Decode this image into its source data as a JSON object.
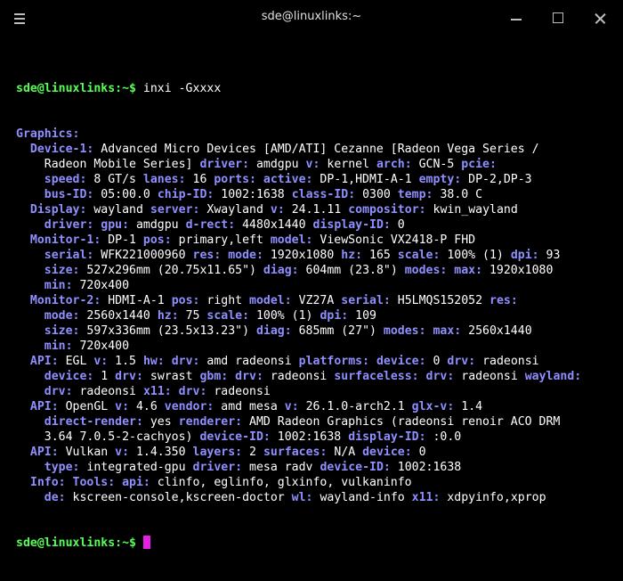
{
  "window": {
    "title": "sde@linuxlinks:~",
    "menu_icon": "hamburger-menu-icon",
    "minimize_icon": "minimize-icon",
    "maximize_icon": "maximize-icon",
    "close_icon": "close-icon"
  },
  "colors": {
    "background": "#000000",
    "prompt": "#55ff55",
    "key": "#8f8fff",
    "value": "#ffffff",
    "cursor": "#e61ee6"
  },
  "terminal": {
    "prompt": "sde@linuxlinks:~$",
    "command": " inxi -Gxxxx",
    "lines": [
      [
        [
          "k",
          "Graphics:"
        ]
      ],
      [
        [
          "k",
          "  Device-1: "
        ],
        [
          "v",
          "Advanced Micro Devices [AMD/ATI] Cezanne [Radeon Vega Series /"
        ]
      ],
      [
        [
          "v",
          "    Radeon Mobile Series] "
        ],
        [
          "k",
          "driver: "
        ],
        [
          "v",
          "amdgpu "
        ],
        [
          "k",
          "v: "
        ],
        [
          "v",
          "kernel "
        ],
        [
          "k",
          "arch: "
        ],
        [
          "v",
          "GCN-5 "
        ],
        [
          "k",
          "pcie:"
        ]
      ],
      [
        [
          "k",
          "    speed: "
        ],
        [
          "v",
          "8 GT/s "
        ],
        [
          "k",
          "lanes: "
        ],
        [
          "v",
          "16 "
        ],
        [
          "k",
          "ports: active: "
        ],
        [
          "v",
          "DP-1,HDMI-A-1 "
        ],
        [
          "k",
          "empty: "
        ],
        [
          "v",
          "DP-2,DP-3"
        ]
      ],
      [
        [
          "k",
          "    bus-ID: "
        ],
        [
          "v",
          "05:00.0 "
        ],
        [
          "k",
          "chip-ID: "
        ],
        [
          "v",
          "1002:1638 "
        ],
        [
          "k",
          "class-ID: "
        ],
        [
          "v",
          "0300 "
        ],
        [
          "k",
          "temp: "
        ],
        [
          "v",
          "38.0 C"
        ]
      ],
      [
        [
          "k",
          "  Display: "
        ],
        [
          "v",
          "wayland "
        ],
        [
          "k",
          "server: "
        ],
        [
          "v",
          "Xwayland "
        ],
        [
          "k",
          "v: "
        ],
        [
          "v",
          "24.1.11 "
        ],
        [
          "k",
          "compositor: "
        ],
        [
          "v",
          "kwin_wayland"
        ]
      ],
      [
        [
          "k",
          "    driver: gpu: "
        ],
        [
          "v",
          "amdgpu "
        ],
        [
          "k",
          "d-rect: "
        ],
        [
          "v",
          "4480x1440 "
        ],
        [
          "k",
          "display-ID: "
        ],
        [
          "v",
          "0"
        ]
      ],
      [
        [
          "k",
          "  Monitor-1: "
        ],
        [
          "v",
          "DP-1 "
        ],
        [
          "k",
          "pos: "
        ],
        [
          "v",
          "primary,left "
        ],
        [
          "k",
          "model: "
        ],
        [
          "v",
          "ViewSonic VX2418-P FHD"
        ]
      ],
      [
        [
          "k",
          "    serial: "
        ],
        [
          "v",
          "WFK221000960 "
        ],
        [
          "k",
          "res: mode: "
        ],
        [
          "v",
          "1920x1080 "
        ],
        [
          "k",
          "hz: "
        ],
        [
          "v",
          "165 "
        ],
        [
          "k",
          "scale: "
        ],
        [
          "v",
          "100% (1) "
        ],
        [
          "k",
          "dpi: "
        ],
        [
          "v",
          "93"
        ]
      ],
      [
        [
          "k",
          "    size: "
        ],
        [
          "v",
          "527x296mm (20.75x11.65\") "
        ],
        [
          "k",
          "diag: "
        ],
        [
          "v",
          "604mm (23.8\") "
        ],
        [
          "k",
          "modes: max: "
        ],
        [
          "v",
          "1920x1080"
        ]
      ],
      [
        [
          "k",
          "    min: "
        ],
        [
          "v",
          "720x400"
        ]
      ],
      [
        [
          "k",
          "  Monitor-2: "
        ],
        [
          "v",
          "HDMI-A-1 "
        ],
        [
          "k",
          "pos: "
        ],
        [
          "v",
          "right "
        ],
        [
          "k",
          "model: "
        ],
        [
          "v",
          "VZ27A "
        ],
        [
          "k",
          "serial: "
        ],
        [
          "v",
          "H5LMQS152052 "
        ],
        [
          "k",
          "res:"
        ]
      ],
      [
        [
          "k",
          "    mode: "
        ],
        [
          "v",
          "2560x1440 "
        ],
        [
          "k",
          "hz: "
        ],
        [
          "v",
          "75 "
        ],
        [
          "k",
          "scale: "
        ],
        [
          "v",
          "100% (1) "
        ],
        [
          "k",
          "dpi: "
        ],
        [
          "v",
          "109"
        ]
      ],
      [
        [
          "k",
          "    size: "
        ],
        [
          "v",
          "597x336mm (23.5x13.23\") "
        ],
        [
          "k",
          "diag: "
        ],
        [
          "v",
          "685mm (27\") "
        ],
        [
          "k",
          "modes: max: "
        ],
        [
          "v",
          "2560x1440"
        ]
      ],
      [
        [
          "k",
          "    min: "
        ],
        [
          "v",
          "720x400"
        ]
      ],
      [
        [
          "k",
          "  API: "
        ],
        [
          "v",
          "EGL "
        ],
        [
          "k",
          "v: "
        ],
        [
          "v",
          "1.5 "
        ],
        [
          "k",
          "hw: drv: "
        ],
        [
          "v",
          "amd radeonsi "
        ],
        [
          "k",
          "platforms: device: "
        ],
        [
          "v",
          "0 "
        ],
        [
          "k",
          "drv: "
        ],
        [
          "v",
          "radeonsi"
        ]
      ],
      [
        [
          "k",
          "    device: "
        ],
        [
          "v",
          "1 "
        ],
        [
          "k",
          "drv: "
        ],
        [
          "v",
          "swrast "
        ],
        [
          "k",
          "gbm: drv: "
        ],
        [
          "v",
          "radeonsi "
        ],
        [
          "k",
          "surfaceless: drv: "
        ],
        [
          "v",
          "radeonsi "
        ],
        [
          "k",
          "wayland:"
        ]
      ],
      [
        [
          "k",
          "    drv: "
        ],
        [
          "v",
          "radeonsi "
        ],
        [
          "k",
          "x11: drv: "
        ],
        [
          "v",
          "radeonsi"
        ]
      ],
      [
        [
          "k",
          "  API: "
        ],
        [
          "v",
          "OpenGL "
        ],
        [
          "k",
          "v: "
        ],
        [
          "v",
          "4.6 "
        ],
        [
          "k",
          "vendor: "
        ],
        [
          "v",
          "amd mesa "
        ],
        [
          "k",
          "v: "
        ],
        [
          "v",
          "26.1.0-arch2.1 "
        ],
        [
          "k",
          "glx-v: "
        ],
        [
          "v",
          "1.4"
        ]
      ],
      [
        [
          "k",
          "    direct-render: "
        ],
        [
          "v",
          "yes "
        ],
        [
          "k",
          "renderer: "
        ],
        [
          "v",
          "AMD Radeon Graphics (radeonsi renoir ACO DRM"
        ]
      ],
      [
        [
          "v",
          "    3.64 7.0.5-2-cachyos) "
        ],
        [
          "k",
          "device-ID: "
        ],
        [
          "v",
          "1002:1638 "
        ],
        [
          "k",
          "display-ID: "
        ],
        [
          "v",
          ":0.0"
        ]
      ],
      [
        [
          "k",
          "  API: "
        ],
        [
          "v",
          "Vulkan "
        ],
        [
          "k",
          "v: "
        ],
        [
          "v",
          "1.4.350 "
        ],
        [
          "k",
          "layers: "
        ],
        [
          "v",
          "2 "
        ],
        [
          "k",
          "surfaces: "
        ],
        [
          "v",
          "N/A "
        ],
        [
          "k",
          "device: "
        ],
        [
          "v",
          "0"
        ]
      ],
      [
        [
          "k",
          "    type: "
        ],
        [
          "v",
          "integrated-gpu "
        ],
        [
          "k",
          "driver: "
        ],
        [
          "v",
          "mesa radv "
        ],
        [
          "k",
          "device-ID: "
        ],
        [
          "v",
          "1002:1638"
        ]
      ],
      [
        [
          "k",
          "  Info: Tools: api: "
        ],
        [
          "v",
          "clinfo, eglinfo, glxinfo, vulkaninfo"
        ]
      ],
      [
        [
          "k",
          "    de: "
        ],
        [
          "v",
          "kscreen-console,kscreen-doctor "
        ],
        [
          "k",
          "wl: "
        ],
        [
          "v",
          "wayland-info "
        ],
        [
          "k",
          "x11: "
        ],
        [
          "v",
          "xdpyinfo,xprop"
        ]
      ]
    ],
    "final_prompt": "sde@linuxlinks:~$"
  }
}
